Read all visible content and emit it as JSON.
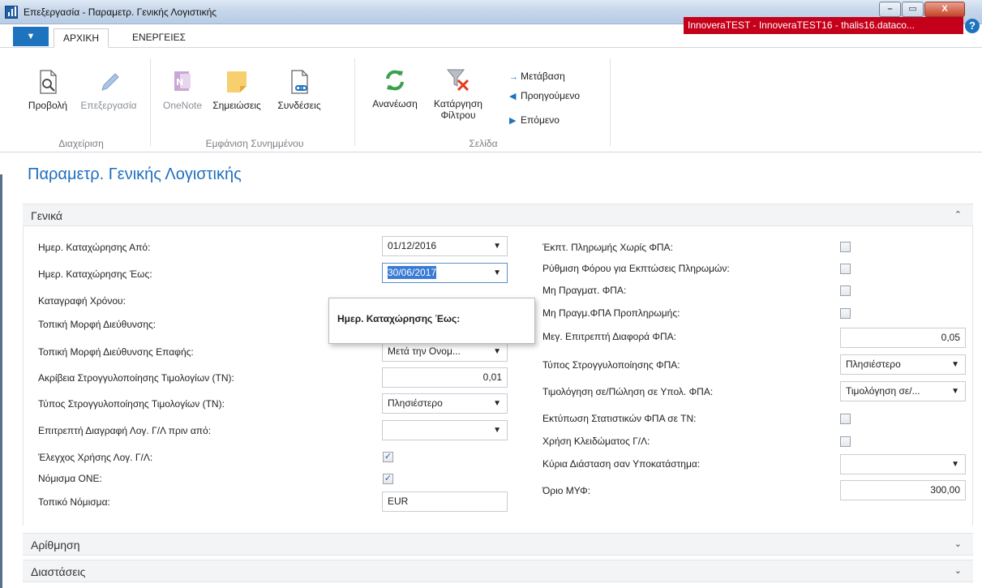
{
  "window": {
    "title": "Επεξεργασία - Παραμετρ. Γενικής Λογιστικής",
    "min_label": "–",
    "max_label": "▭",
    "close_label": "X"
  },
  "tabs": {
    "menu_arrow": "▼",
    "home": "ΑΡΧΙΚΗ",
    "actions": "ΕΝΕΡΓΕΙΕΣ"
  },
  "company": {
    "banner": "InnoveraTEST - InnoveraTEST16 - thalis16.dataco...",
    "help": "?"
  },
  "ribbon": {
    "groups": [
      {
        "label": "Διαχείριση"
      },
      {
        "label": "Εμφάνιση Συνημμένου"
      },
      {
        "label": "Σελίδα"
      }
    ],
    "buttons": {
      "view": "Προβολή",
      "edit": "Επεξεργασία",
      "onenote": "OneNote",
      "notes": "Σημειώσεις",
      "links": "Συνδέσεις",
      "refresh": "Ανανέωση",
      "clear_filter_1": "Κατάργηση",
      "clear_filter_2": "Φίλτρου"
    },
    "nav": {
      "goto": "Μετάβαση",
      "previous": "Προηγούμενο",
      "next": "Επόμενο"
    }
  },
  "page": {
    "title": "Παραμετρ. Γενικής Λογιστικής"
  },
  "sections": {
    "general": "Γενικά",
    "numbering": "Αρίθμηση",
    "dimensions": "Διαστάσεις"
  },
  "left_fields": [
    {
      "label": "Ημερ. Καταχώρησης Από:",
      "value": "01/12/2016"
    },
    {
      "label": "Ημερ. Καταχώρησης Έως:",
      "value": "30/06/2017"
    },
    {
      "label": "Καταγραφή Χρόνου:"
    },
    {
      "label": "Τοπική Μορφή Διεύθυνσης:"
    },
    {
      "label": "Τοπική Μορφή Διεύθυνσης Επαφής:",
      "value": "Μετά την Ονομ..."
    },
    {
      "label": "Ακρίβεια Στρογγυλοποίησης Τιμολογίων (ΤΝ):",
      "value": "0,01"
    },
    {
      "label": "Τύπος Στρογγυλοποίησης Τιμολογίων (ΤΝ):",
      "value": "Πλησιέστερο"
    },
    {
      "label": "Επιτρεπτή Διαγραφή Λογ. Γ/Λ πριν από:",
      "value": ""
    },
    {
      "label": "Έλεγχος Χρήσης Λογ. Γ/Λ:",
      "checked": true
    },
    {
      "label": "Νόμισμα ΟΝΕ:",
      "checked": true
    },
    {
      "label": "Τοπικό Νόμισμα:",
      "value": "EUR"
    }
  ],
  "right_fields": [
    {
      "label": "Έκπτ. Πληρωμής Χωρίς ΦΠΑ:",
      "checked": false
    },
    {
      "label": "Ρύθμιση Φόρου για Εκπτώσεις Πληρωμών:",
      "checked": false
    },
    {
      "label": "Μη Πραγματ. ΦΠΑ:",
      "checked": false
    },
    {
      "label": "Μη Πραγμ.ΦΠΑ Προπληρωμής:",
      "checked": false
    },
    {
      "label": "Μεγ. Επιτρεπτή Διαφορά ΦΠΑ:",
      "value": "0,05"
    },
    {
      "label": "Τύπος Στρογγυλοποίησης ΦΠΑ:",
      "value": "Πλησιέστερο"
    },
    {
      "label": "Τιμολόγηση σε/Πώληση σε Υπολ. ΦΠΑ:",
      "value": "Τιμολόγηση σε/..."
    },
    {
      "label": "Εκτύπωση Στατιστικών ΦΠΑ σε ΤΝ:",
      "checked": false
    },
    {
      "label": "Χρήση Κλειδώματος Γ/Λ:",
      "checked": false
    },
    {
      "label": "Κύρια Διάσταση σαν Υποκατάστημα:",
      "value": ""
    },
    {
      "label": "Όριο ΜΥΦ:",
      "value": "300,00"
    }
  ],
  "tooltip": {
    "text": "Ημερ. Καταχώρησης Έως:"
  },
  "glyphs": {
    "caret": "▼",
    "check": "✓",
    "chevron_up": "⌃",
    "chevron_down": "⌄"
  }
}
